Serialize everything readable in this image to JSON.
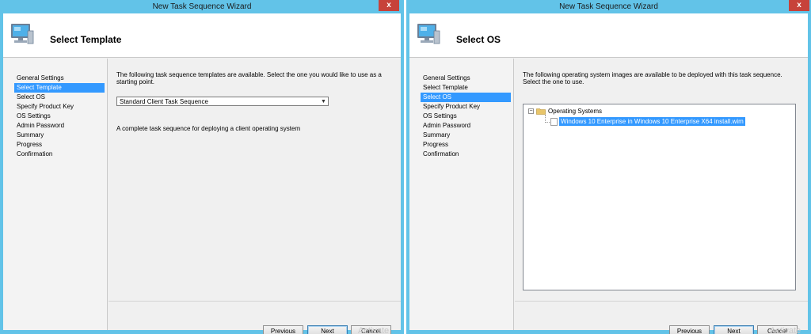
{
  "left_window": {
    "title": "New Task Sequence Wizard",
    "close_label": "x",
    "page_title": "Select Template",
    "nav_items": [
      "General Settings",
      "Select Template",
      "Select OS",
      "Specify Product Key",
      "OS Settings",
      "Admin Password",
      "Summary",
      "Progress",
      "Confirmation"
    ],
    "selected_nav": "Select Template",
    "description": "The following task sequence templates are available.  Select the one you would like to use as a starting point.",
    "template_dropdown": {
      "selected": "Standard Client Task Sequence"
    },
    "template_description": "A complete task sequence for deploying a client operating system",
    "buttons": {
      "previous": "Previous",
      "next": "Next",
      "cancel": "Cancel"
    },
    "watermark": "Activate"
  },
  "right_window": {
    "title": "New Task Sequence Wizard",
    "close_label": "x",
    "page_title": "Select OS",
    "nav_items": [
      "General Settings",
      "Select Template",
      "Select OS",
      "Specify Product Key",
      "OS Settings",
      "Admin Password",
      "Summary",
      "Progress",
      "Confirmation"
    ],
    "selected_nav": "Select OS",
    "description": "The following operating system images are available to be deployed with this task sequence.  Select the one to use.",
    "tree": {
      "root_label": "Operating Systems",
      "expander": "−",
      "child_label": "Windows 10 Enterprise in Windows 10 Enterprise X64 install.wim"
    },
    "buttons": {
      "previous": "Previous",
      "next": "Next",
      "cancel": "Cancel"
    },
    "watermark": "Activate"
  },
  "colors": {
    "frame": "#62c3e8",
    "selection": "#3399ff",
    "close": "#c7423a"
  }
}
